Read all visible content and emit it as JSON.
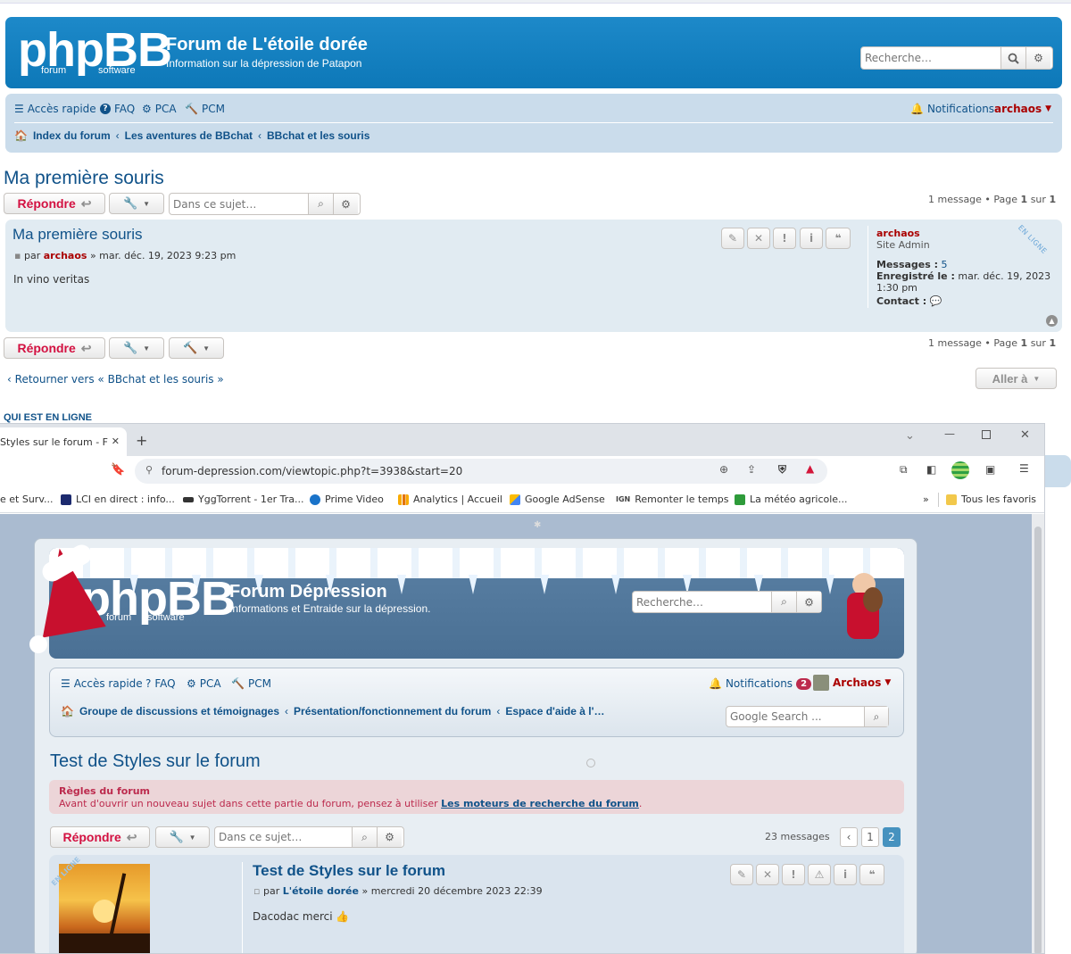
{
  "outer": {
    "logo_text": "phpBB",
    "logo_sub_left": "forum",
    "logo_sub_right": "software",
    "site_title": "Forum de L'étoile dorée",
    "site_desc": "Information sur la dépression de Patapon",
    "search_placeholder": "Recherche…",
    "nav": {
      "quick": "Accès rapide",
      "faq": "FAQ",
      "pca": "PCA",
      "pcm": "PCM",
      "notifications": "Notifications",
      "user": "archaos"
    },
    "breadcrumb": [
      "Index du forum",
      "Les aventures de BBchat",
      "BBchat et les souris"
    ],
    "topic_title": "Ma première souris",
    "reply_label": "Répondre",
    "topic_search_placeholder": "Dans ce sujet…",
    "pagination": {
      "prefix": "1 message • Page",
      "page": "1",
      "sep": "sur",
      "total": "1"
    },
    "post": {
      "title": "Ma première souris",
      "by": "par",
      "author": "archaos",
      "date": "» mar. déc. 19, 2023 9:23 pm",
      "body": "In vino veritas",
      "profile": {
        "name": "archaos",
        "rank": "Site Admin",
        "messages_label": "Messages :",
        "messages_value": "5",
        "registered_label": "Enregistré le :",
        "registered_value": "mar. déc. 19, 2023",
        "registered_time": "1:30 pm",
        "contact_label": "Contact :",
        "online_ribbon": "EN LIGNE"
      }
    },
    "return_prefix": "Retourner vers «",
    "return_link": "BBchat et les souris",
    "return_suffix": "»",
    "jump_label": "Aller à",
    "online_header": "QUI EST EN LIGNE"
  },
  "browser": {
    "tab_title": "Styles sur le forum - F",
    "url": "forum-depression.com/viewtopic.php?t=3938&start=20",
    "bookmarks": [
      "e et Surv...",
      "LCI en direct : info...",
      "YggTorrent - 1er Tra...",
      "Prime Video",
      "Analytics | Accueil",
      "Google AdSense",
      "Remonter le temps",
      "La météo agricole..."
    ],
    "bookmark_more": "»",
    "bookmark_all": "Tous les favoris",
    "colors": {
      "tabbar": "#dfe3e8",
      "urlbox": "#eef1f5"
    }
  },
  "inner": {
    "logo_text": "phpBB",
    "logo_sub_left": "forum",
    "logo_sub_right": "software",
    "site_title": "Forum Dépression",
    "site_desc": "Informations et Entraide sur la dépression.",
    "search_placeholder": "Recherche…",
    "nav": {
      "quick": "Accès rapide",
      "faq": "FAQ",
      "pca": "PCA",
      "pcm": "PCM",
      "notifications": "Notifications",
      "notif_count": "2",
      "user": "Archaos"
    },
    "breadcrumb": [
      "Groupe de discussions et témoignages",
      "Présentation/fonctionnement du forum",
      "Espace d'aide à l'…"
    ],
    "google_search": "Google Search ...",
    "topic_title": "Test de Styles sur le forum",
    "rules_title": "Règles du forum",
    "rules_text": "Avant d'ouvrir un nouveau sujet dans cette partie du forum, pensez à utiliser",
    "rules_link": "Les moteurs de recherche du forum",
    "rules_end": ".",
    "reply_label": "Répondre",
    "topic_search_placeholder": "Dans ce sujet…",
    "messages_count": "23 messages",
    "pages": [
      "1",
      "2"
    ],
    "post": {
      "title": "Test de Styles sur le forum",
      "by": "par",
      "author": "L'étoile dorée",
      "date": "» mercredi 20 décembre 2023 22:39",
      "body": "Dacodac merci",
      "online_ribbon": "EN LIGNE"
    }
  }
}
